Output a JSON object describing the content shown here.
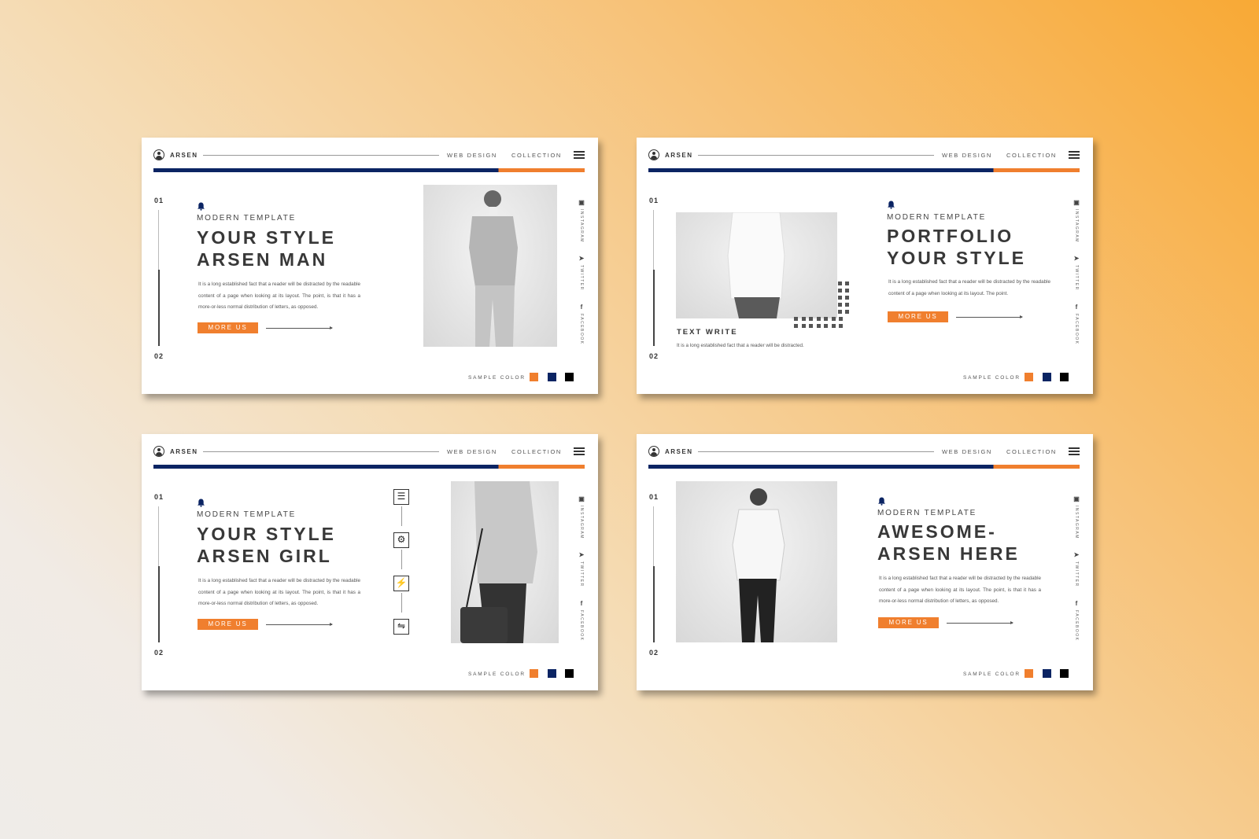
{
  "colors": {
    "navy": "#0b2463",
    "orange": "#f07f2e",
    "black": "#000000",
    "background_from": "#efece8",
    "background_to": "#f8a935"
  },
  "header": {
    "brand": "ARSEN",
    "nav": [
      "WEB DESIGN",
      "COLLECTION"
    ],
    "logo_icon": "user-circle-icon",
    "menu_icon": "hamburger-icon"
  },
  "numbers": [
    "01",
    "02"
  ],
  "social": [
    {
      "icon": "instagram-icon",
      "label": "INSTAGRAM"
    },
    {
      "icon": "twitter-icon",
      "label": "TWITTER"
    },
    {
      "icon": "facebook-icon",
      "label": "FACEBOOK"
    }
  ],
  "sample_color_label": "SAMPLE COLOR",
  "slides": [
    {
      "subtitle": "MODERN TEMPLATE",
      "title": "YOUR STYLE\nARSEN MAN",
      "paragraph": "It is a long established fact that a reader will be distracted by the readable content of a page when looking at its layout. The point, is that it has a more-or-less normal distribution of letters, as opposed.",
      "button": "MORE US"
    },
    {
      "subtitle": "MODERN TEMPLATE",
      "title": "PORTFOLIO\nYOUR STYLE",
      "paragraph": "It is a long established fact that a reader will be distracted by the readable content of a page when looking at its layout. The point.",
      "button": "MORE US",
      "caption_title": "TEXT WRITE",
      "caption_text": "It is a long established fact that a reader will be distracted."
    },
    {
      "subtitle": "MODERN TEMPLATE",
      "title": "YOUR STYLE\nARSEN GIRL",
      "paragraph": "It is a long established fact that a reader will be distracted by the readable content of a page when looking at its layout. The point, is that it has a more-or-less normal distribution of letters, as opposed.",
      "button": "MORE US",
      "feature_icons": [
        "layers-icon",
        "gear-icon",
        "plug-icon",
        "sliders-icon"
      ]
    },
    {
      "subtitle": "MODERN TEMPLATE",
      "title": "AWESOME-\nARSEN HERE",
      "paragraph": "It is a long established fact that a reader will be distracted by the readable content of a page when looking at its layout. The point, is that it has a more-or-less normal distribution of letters, as opposed.",
      "button": "MORE US"
    }
  ]
}
